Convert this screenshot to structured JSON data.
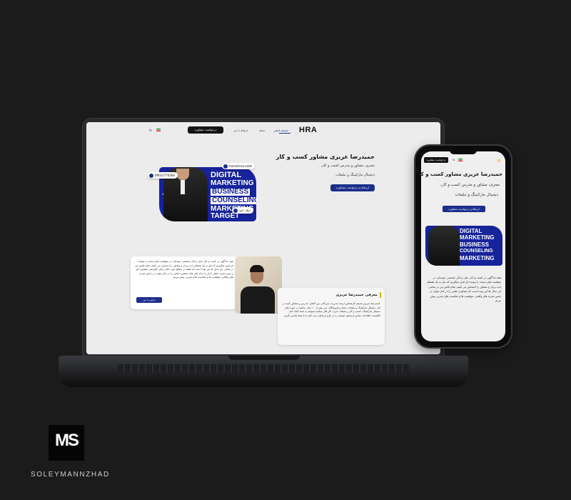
{
  "site": {
    "logo": "HRA",
    "lang": "fa",
    "nav": {
      "cta": "درخواست مشاوره",
      "links": [
        "ارتباط با من",
        "مجله",
        "صفحه اصلی"
      ]
    },
    "hero": {
      "title": "حمیدرضا عزیزی مشاور کسب و کار",
      "subtitle1": "مجری، مشاور و مدرس کسب و کار،",
      "subtitle2": "دیجیتال مارکتینگ و تبلیغات",
      "button": "ارتباط و درخواست مشاوره"
    },
    "banner": {
      "lines": [
        "DIGITAL",
        "MARKETING",
        "BUSINESS",
        "COUNSELING",
        "MARKETING",
        "TARGET"
      ],
      "instagram": "hamidreza.azizii",
      "phone": "09023776366",
      "follow": "دنبال کنید"
    },
    "about": {
      "paragraph": "همه ما آگهی در کسب و کار، مثل زندگی شخصی خودمان، در موقعیت های سخت یا پیچیده ای قرار میگیریم که نیاز به یک همفکر ایده پرداز و مشاور را احساس می کنیم. تمام تلاش من در تمامی این سال ها این بوده است که فقط در سطح خوب های زیبای انگیزشی مشاوره ای و بدون تجربه عملی ابزار را ارائه کنم بلکه مشاوره علمی را در کنار موارد در جنس تجربه های واقعی، موفقیت ها و شکست های تجربی پیش ببریم.",
      "button": "تماس با من"
    },
    "intro": {
      "title": "معرفی حمیدرضا عزیزی",
      "paragraph": "حمیدرضا عزیزی هستم کارشناس ارشد مدیریت بازرگانی بین الملل، مدرس و مشاور کسب و کار، دیجیتال مارکتینگ و تبلیغات مجله و فروشگاه. من بیش از ۱۰ سال سابقه در حوزه های دیجیتال مارکتینگ، کسب و کار و تبلیغات دارم. اگر فکر میکنید میتوانم به شما کمک کنم کافیست اطلاعات تماس آزمایش خودتان را در فرم ارتباطی ثبت کنید تا با شما تماس بگیرم."
    }
  },
  "mobile": {
    "cta": "درخواست مشاوره",
    "title": "حمیدرضا عزیزی مشاور کسب و کار",
    "subtitle1": "مجری، مشاور و مدرس کسب و کار،",
    "subtitle2": "دیجیتال مارکتینگ و تبلیغات",
    "button": "ارتباط و درخواست مشاوره",
    "banner_lines": [
      "DIGITAL",
      "MARKETING",
      "BUSINESS",
      "COUNSELING",
      "MARKETING"
    ],
    "paragraph": "همه ما آگهی در کسب و کار، مثل زندگی شخصی خودمان، در موقعیت های سخت یا پیچیده ای قرار میگیریم که نیاز به یک همفکر ایده پرداز و مشاور را احساس می کنیم. تمام تلاش من در تمامی این سال ها این بوده است که مشاوره علمی را در کنار موارد در جنس تجربه های واقعی، موفقیت ها و شکست های تجربی پیش ببریم."
  },
  "brand": {
    "mark": "MS",
    "name": "SOLEYMANNZHAD"
  },
  "colors": {
    "background": "#1b1b1c",
    "accent_blue": "#1c2f8d",
    "accent_yellow": "#e0b000"
  }
}
